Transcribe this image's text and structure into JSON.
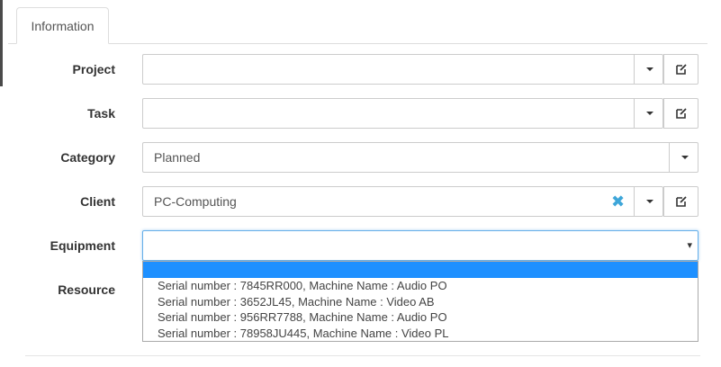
{
  "tabs": [
    {
      "label": "Information"
    }
  ],
  "form": {
    "project": {
      "label": "Project",
      "value": ""
    },
    "task": {
      "label": "Task",
      "value": ""
    },
    "category": {
      "label": "Category",
      "value": "Planned"
    },
    "client": {
      "label": "Client",
      "value": "PC-Computing",
      "clear_glyph": "✖"
    },
    "equipment": {
      "label": "Equipment",
      "value": "",
      "arrow_glyph": "▾"
    },
    "resource": {
      "label": "Resource"
    }
  },
  "equipment_dropdown": {
    "options": [
      "",
      "Serial number : 7845RR000, Machine Name : Audio PO",
      "Serial number : 3652JL45, Machine Name : Video AB",
      "Serial number : 956RR7788, Machine Name : Audio PO",
      "Serial number : 78958JU445, Machine Name : Video PL"
    ],
    "highlighted_index": 0
  },
  "icons": {
    "dropdown": "caret-down-icon",
    "edit": "edit-icon",
    "clear": "clear-x-icon"
  },
  "colors": {
    "focus_border": "#66afe9",
    "highlight": "#1e90ff",
    "clear_icon": "#3ea6d9"
  }
}
